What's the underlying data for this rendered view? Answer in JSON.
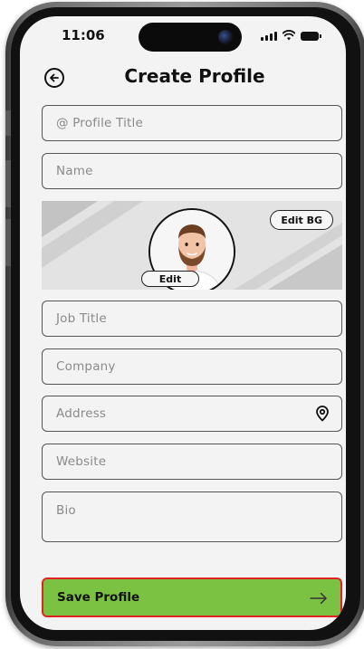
{
  "status_bar": {
    "time": "11:06"
  },
  "header": {
    "title": "Create Profile"
  },
  "fields": {
    "profile_title": {
      "placeholder": "@ Profile Title",
      "value": ""
    },
    "name": {
      "placeholder": "Name",
      "value": ""
    },
    "job_title": {
      "placeholder": "Job Title",
      "value": ""
    },
    "company": {
      "placeholder": "Company",
      "value": ""
    },
    "address": {
      "placeholder": "Address",
      "value": ""
    },
    "website": {
      "placeholder": "Website",
      "value": ""
    },
    "bio": {
      "placeholder": "Bio",
      "value": ""
    }
  },
  "banner": {
    "edit_bg_label": "Edit BG",
    "edit_avatar_label": "Edit"
  },
  "footer": {
    "save_label": "Save Profile"
  },
  "icons": {
    "back": "arrow-left-circle-icon",
    "location": "location-pin-icon",
    "save_arrow": "arrow-right-icon"
  },
  "colors": {
    "accent": "#7cc242",
    "focus_border": "#e02424",
    "screen_bg": "#f3f3f3"
  }
}
